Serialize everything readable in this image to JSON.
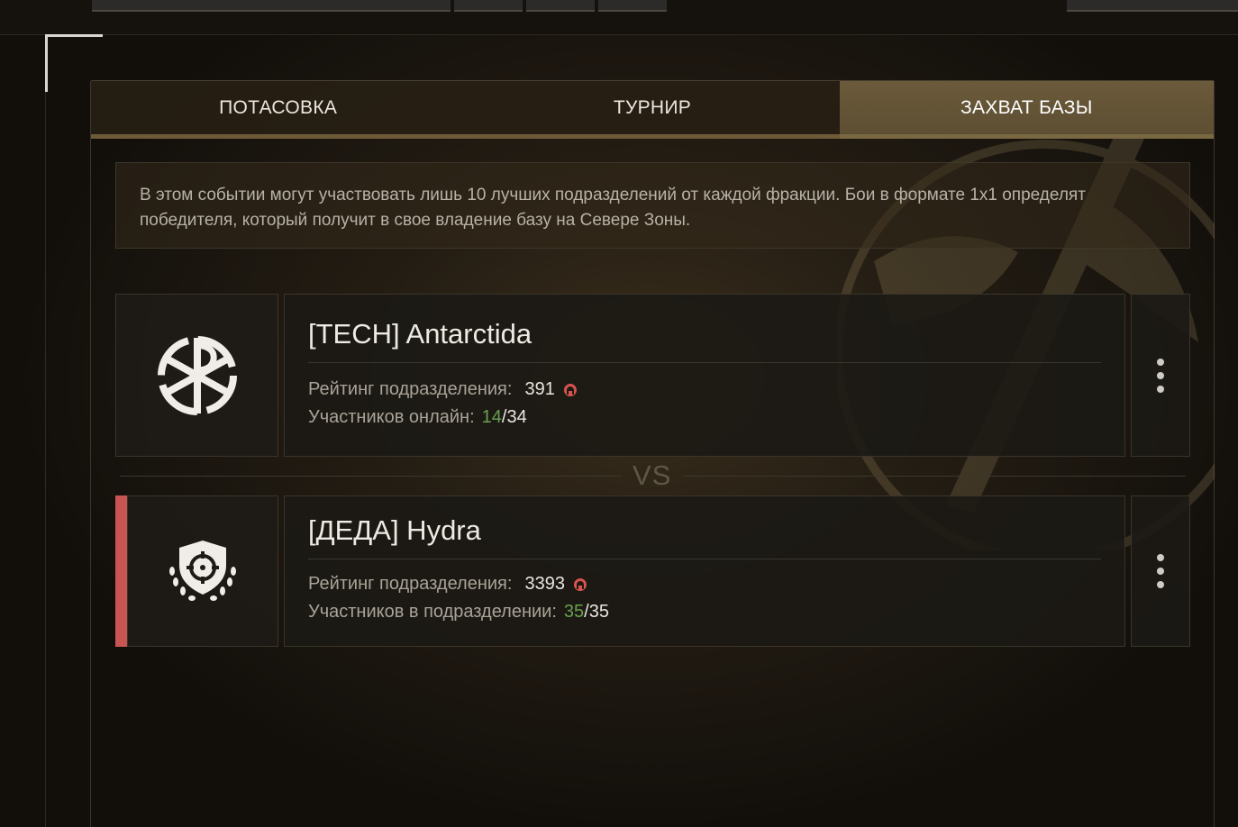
{
  "tabs": [
    {
      "label": "ПОТАСОВКА",
      "active": false
    },
    {
      "label": "ТУРНИР",
      "active": false
    },
    {
      "label": "ЗАХВАТ БАЗЫ",
      "active": true
    }
  ],
  "description": "В этом событии могут участвовать лишь 10 лучших подразделений от каждой фракции. Бои в формате 1х1 определят победителя, который получит в свое владение базу на Севере Зоны.",
  "vs_label": "VS",
  "teams": [
    {
      "name": "[TECH] Antarctida",
      "rating_label": "Рейтинг подразделения:",
      "rating": "391",
      "members_label": "Участников онлайн:",
      "members_current": "14",
      "members_total": "34",
      "logo_icon": "chi-rho-wheel-icon"
    },
    {
      "name": "[ДЕДА] Hydra",
      "rating_label": "Рейтинг подразделения:",
      "rating": "3393",
      "members_label": "Участников в подразделении:",
      "members_current": "35",
      "members_total": "35",
      "logo_icon": "crosshair-shield-icon",
      "highlight_color": "#c95454"
    }
  ],
  "colors": {
    "accent_tab": "#6b5a3a",
    "online_green": "#6aa04e",
    "rating_icon_red": "#d9534f"
  }
}
